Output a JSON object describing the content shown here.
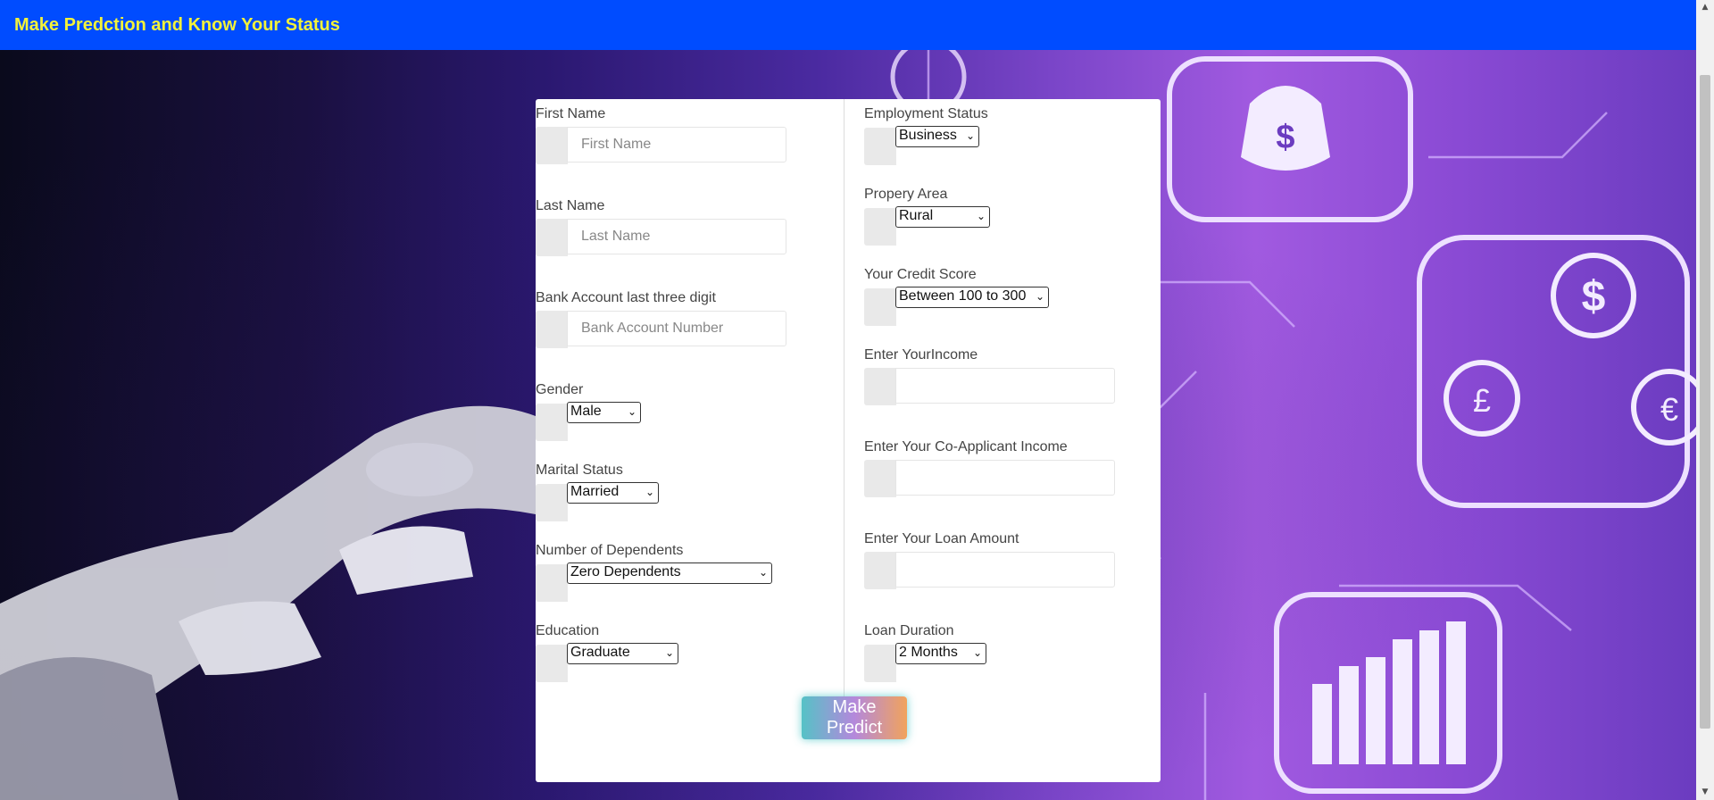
{
  "navbar": {
    "brand": "Make Predction and Know Your Status"
  },
  "form": {
    "left": {
      "first_name": {
        "label": "First Name",
        "placeholder": "First Name",
        "value": ""
      },
      "last_name": {
        "label": "Last Name",
        "placeholder": "Last Name",
        "value": ""
      },
      "bank_account": {
        "label": "Bank Account last three digit",
        "placeholder": "Bank Account Number",
        "value": ""
      },
      "gender": {
        "label": "Gender",
        "selected": "Male"
      },
      "marital_status": {
        "label": "Marital Status",
        "selected": "Married"
      },
      "dependents": {
        "label": "Number of Dependents",
        "selected": "Zero Dependents"
      },
      "education": {
        "label": "Education",
        "selected": "Graduate"
      }
    },
    "right": {
      "employment_status": {
        "label": "Employment Status",
        "selected": "Business"
      },
      "property_area": {
        "label": "Propery Area",
        "selected": "Rural"
      },
      "credit_score": {
        "label": "Your Credit Score",
        "selected": "Between 100 to 300"
      },
      "income": {
        "label": "Enter YourIncome",
        "value": ""
      },
      "coapplicant_income": {
        "label": "Enter Your Co-Applicant Income",
        "value": ""
      },
      "loan_amount": {
        "label": "Enter Your Loan Amount",
        "value": ""
      },
      "loan_duration": {
        "label": "Loan Duration",
        "selected": "2 Months"
      }
    },
    "submit_label": "Make Predict"
  },
  "colors": {
    "navbar": "#004cff",
    "brand_text": "#f3f23a",
    "button_gradient": [
      "#55c2c6",
      "#b488dc",
      "#f1a35c"
    ]
  },
  "background": {
    "icons": [
      "robot-hand-image",
      "money-bag-icon",
      "dollar-coin-icon",
      "pound-coin-icon",
      "euro-coin-icon",
      "bar-chart-icon",
      "circuit-lines"
    ]
  }
}
